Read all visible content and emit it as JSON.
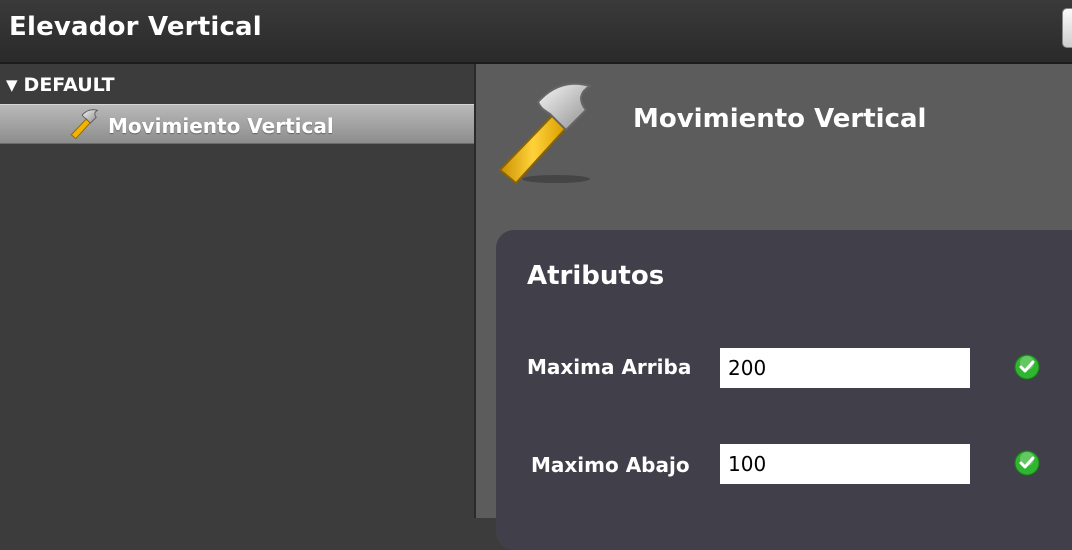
{
  "window": {
    "title": "Elevador Vertical"
  },
  "sidebar": {
    "group": {
      "label": "DEFAULT",
      "icon": "disclosure-triangle-down-icon"
    },
    "items": [
      {
        "label": "Movimiento Vertical",
        "icon": "hammer-icon",
        "selected": true
      }
    ]
  },
  "main": {
    "header": {
      "title": "Movimiento Vertical",
      "icon": "hammer-icon"
    },
    "panel": {
      "title": "Atributos",
      "fields": [
        {
          "label": "Maxima Arriba",
          "value": "200",
          "status_icon": "green-check-icon"
        },
        {
          "label": "Maximo Abajo",
          "value": "100",
          "status_icon": "green-check-icon"
        }
      ]
    }
  },
  "colors": {
    "titlebar": "#2e2e2e",
    "sidebar": "#3c3c3c",
    "main": "#5c5c5c",
    "panel": "#41404a",
    "valid": "#2fb52f",
    "hammer_handle": "#f2b400"
  }
}
